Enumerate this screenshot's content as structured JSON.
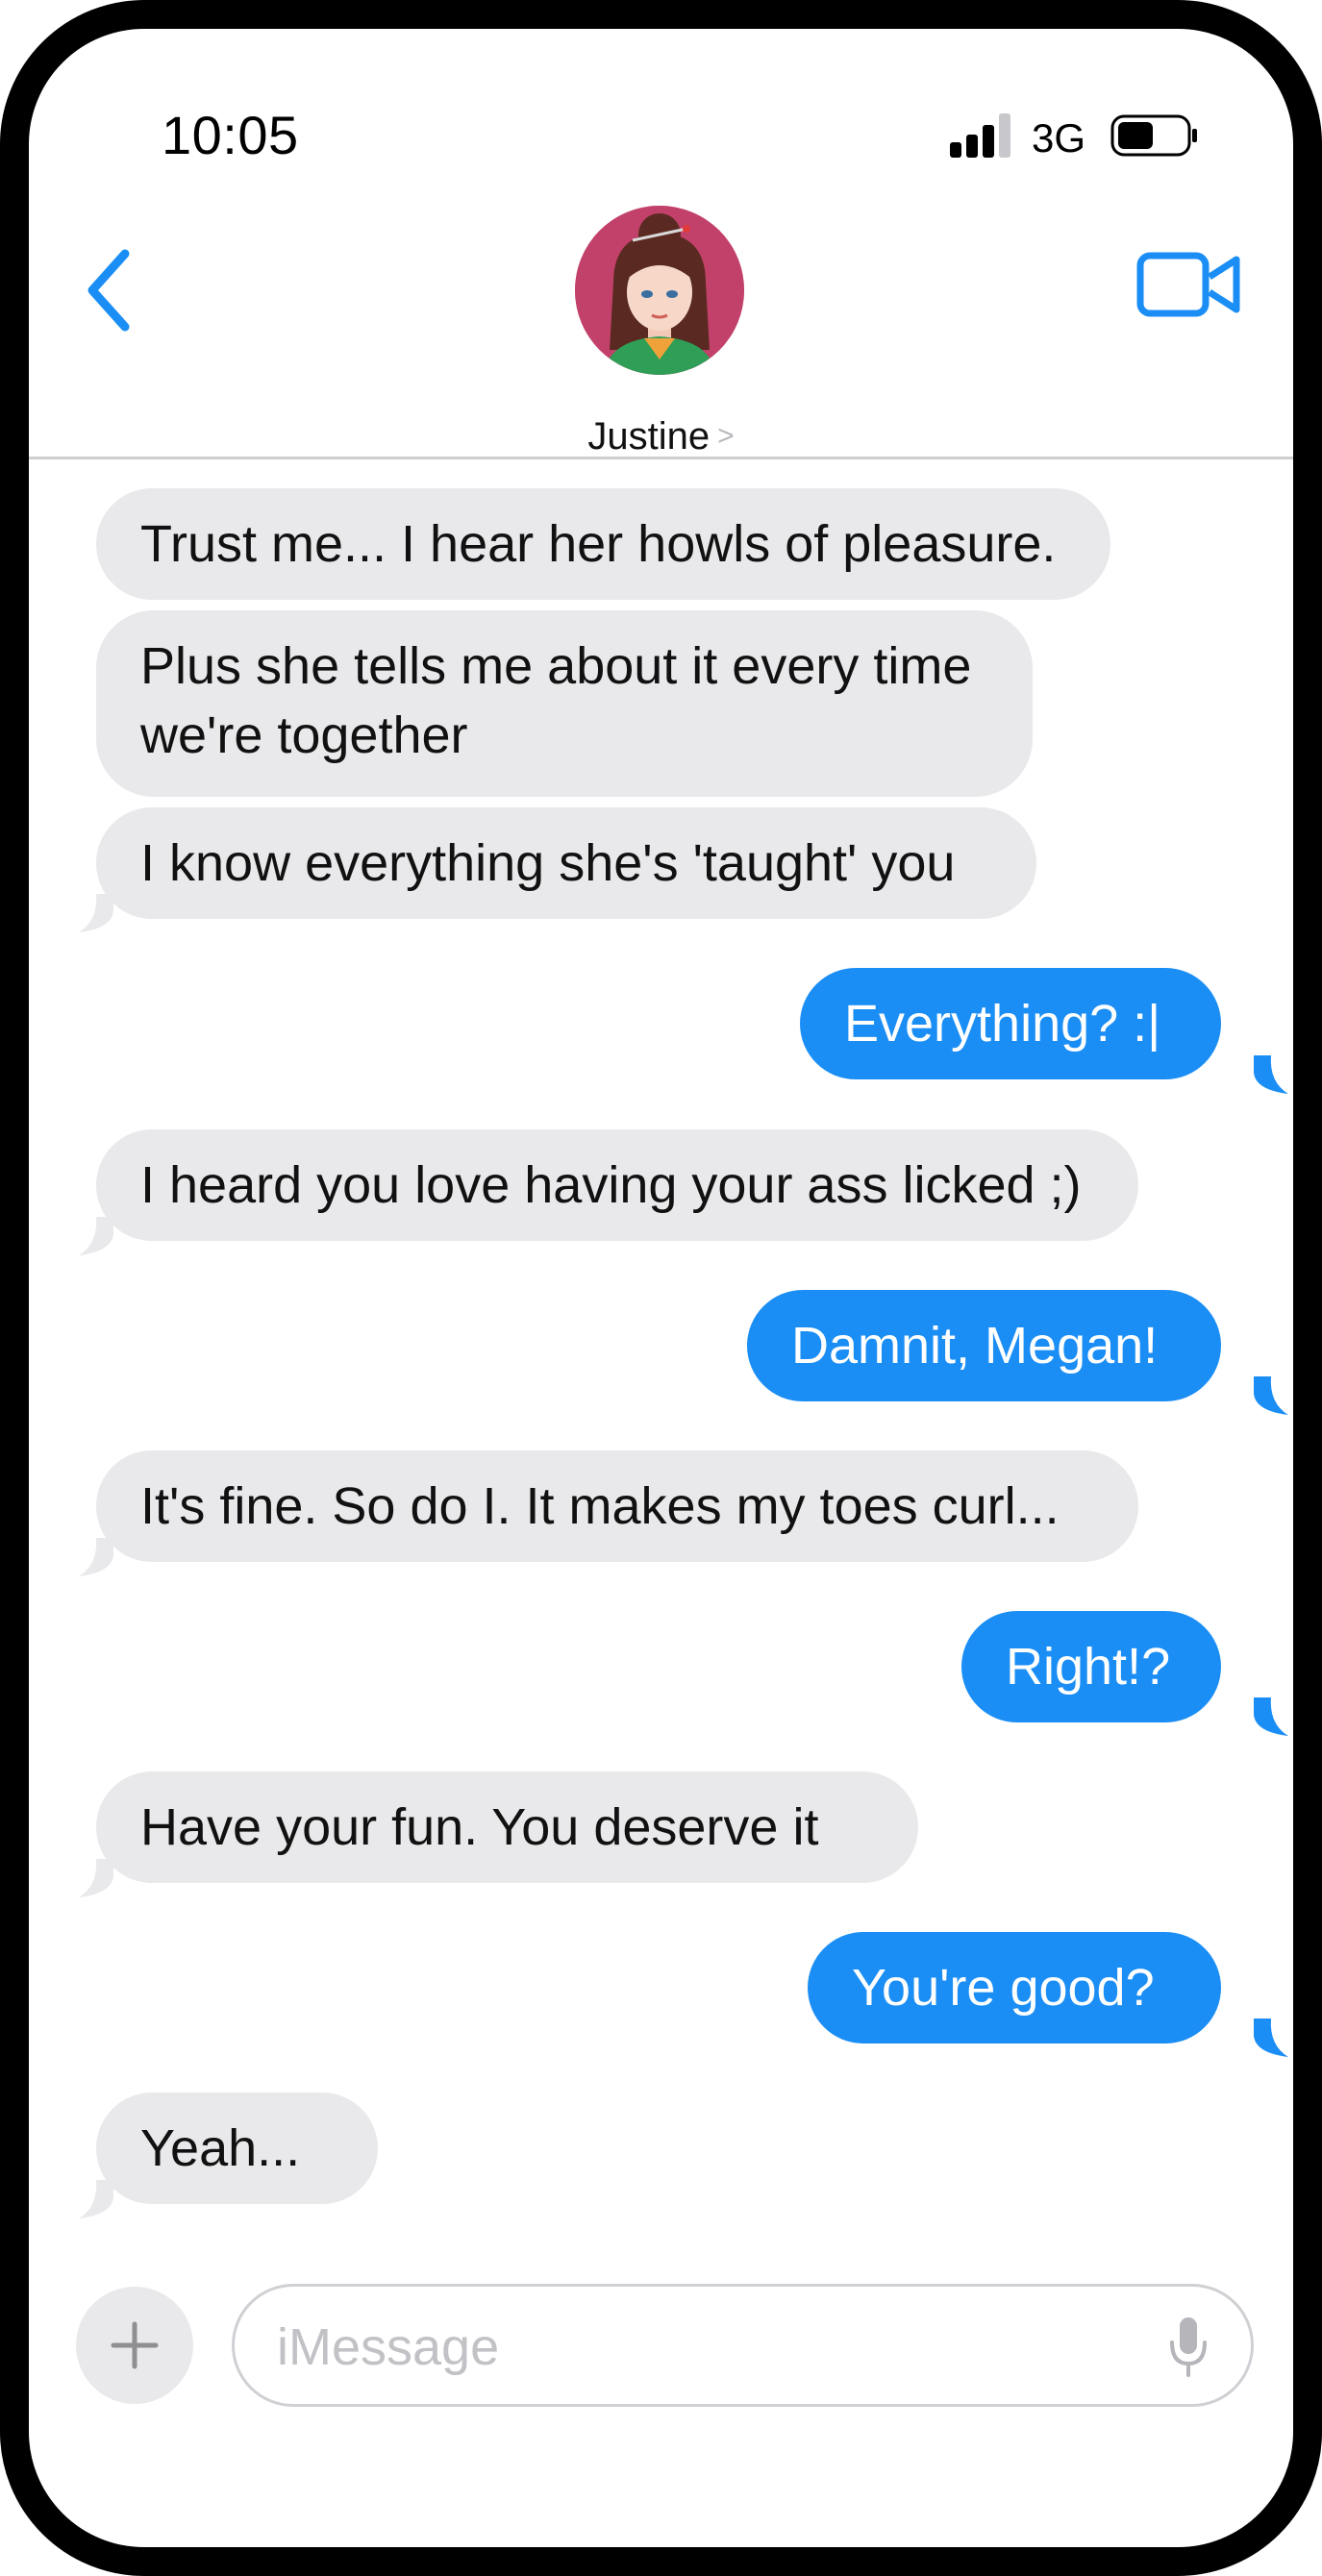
{
  "status_bar": {
    "time": "10:05",
    "network": "3G"
  },
  "header": {
    "contact_name": "Justine",
    "chevron": ">"
  },
  "messages": [
    {
      "direction": "incoming",
      "text": "Trust me... I hear her howls of pleasure."
    },
    {
      "direction": "incoming",
      "text": "Plus she tells me about it every time we're together"
    },
    {
      "direction": "incoming",
      "text": "I know everything she's 'taught' you"
    },
    {
      "direction": "outgoing",
      "text": "Everything? :|"
    },
    {
      "direction": "incoming",
      "text": "I heard you love having your ass licked ;)"
    },
    {
      "direction": "outgoing",
      "text": "Damnit, Megan!"
    },
    {
      "direction": "incoming",
      "text": "It's fine.  So do I.  It makes my toes curl..."
    },
    {
      "direction": "outgoing",
      "text": "Right!?"
    },
    {
      "direction": "incoming",
      "text": "Have your fun.  You deserve it"
    },
    {
      "direction": "outgoing",
      "text": "You're good?"
    },
    {
      "direction": "incoming",
      "text": "Yeah..."
    }
  ],
  "input": {
    "placeholder": "iMessage"
  },
  "icons": {
    "back": "chevron-left-icon",
    "video": "video-camera-icon",
    "plus": "plus-icon",
    "mic": "microphone-icon",
    "signal": "signal-bars-icon",
    "battery": "battery-icon"
  },
  "colors": {
    "accent": "#1b8ef5",
    "incoming_bubble": "#e9e9eb",
    "outgoing_bubble": "#1b8ef5",
    "avatar_bg": "#c2416a"
  }
}
